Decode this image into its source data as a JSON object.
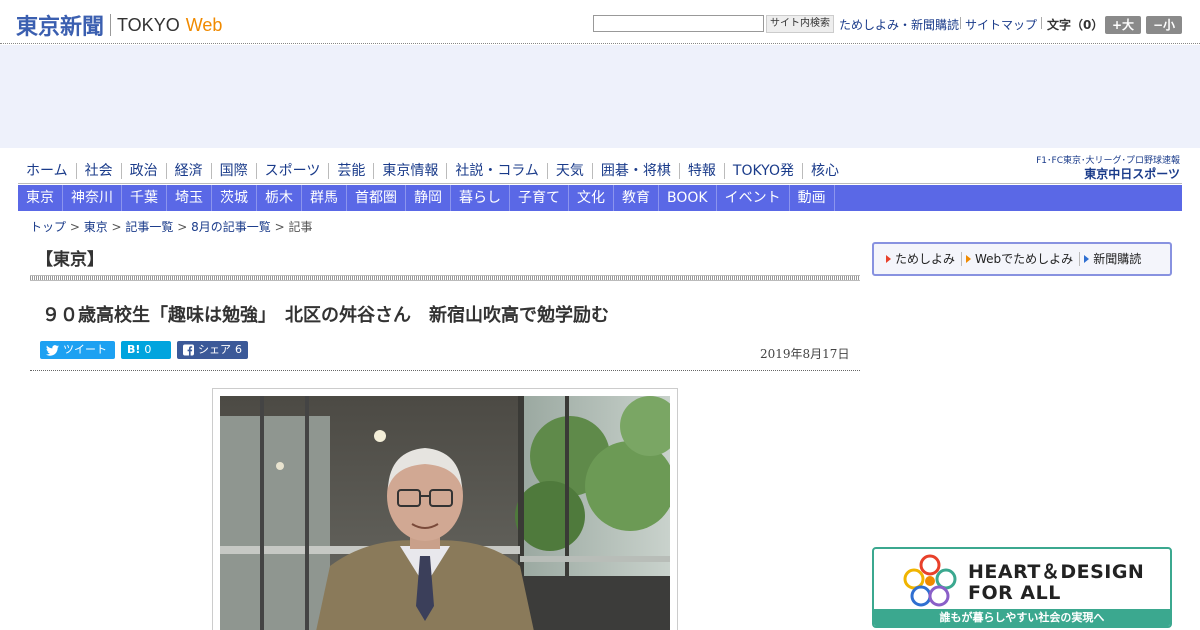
{
  "header": {
    "logo_jp": "東京新聞",
    "logo_tokyo": "TOKYO",
    "logo_web": "Web",
    "search_button": "サイト内検索",
    "trial_link": "ためしよみ・新聞購読",
    "sitemap_link": "サイトマップ",
    "font_label": "文字（0）",
    "font_up": "+大",
    "font_down": "−小"
  },
  "nav_main": [
    "ホーム",
    "社会",
    "政治",
    "経済",
    "国際",
    "スポーツ",
    "芸能",
    "東京情報",
    "社説・コラム",
    "天気",
    "囲碁・将棋",
    "特報",
    "TOKYO発",
    "核心"
  ],
  "nav_sub": [
    "東京",
    "神奈川",
    "千葉",
    "埼玉",
    "茨城",
    "栃木",
    "群馬",
    "首都圏",
    "静岡",
    "暮らし",
    "子育て",
    "文化",
    "教育",
    "BOOK",
    "イベント",
    "動画"
  ],
  "sports_logo": {
    "top": "F1･FC東京･大リーグ･プロ野球速報",
    "bottom": "東京中日スポーツ"
  },
  "breadcrumb": {
    "top": "トップ",
    "tokyo": "東京",
    "list": "記事一覧",
    "month": "8月の記事一覧",
    "current": "記事",
    "sep": " > "
  },
  "section_title": "【東京】",
  "article": {
    "headline": "９０歳高校生「趣味は勉強」　北区の舛谷さん　新宿山吹高で勉学励む",
    "date": "2019年8月17日"
  },
  "share": {
    "tweet_label": "ツイート",
    "hatena_label": "B!",
    "hatena_count": "0",
    "facebook_label": "シェア",
    "facebook_count": "6"
  },
  "sidebar": {
    "tabs": [
      "ためしよみ",
      "Webでためしよみ",
      "新聞購読"
    ],
    "tab_colors": [
      "#e8402a",
      "#f08a00",
      "#2f6fd1"
    ],
    "banner_line1": "HEART＆DESIGN",
    "banner_line2": "FOR ALL",
    "banner_foot": "誰もが暮らしやすい社会の実現へ"
  },
  "colors": {
    "brand_blue": "#3b5fb0",
    "sub_nav": "#5a68e6",
    "banner_green": "#3ba88f"
  }
}
